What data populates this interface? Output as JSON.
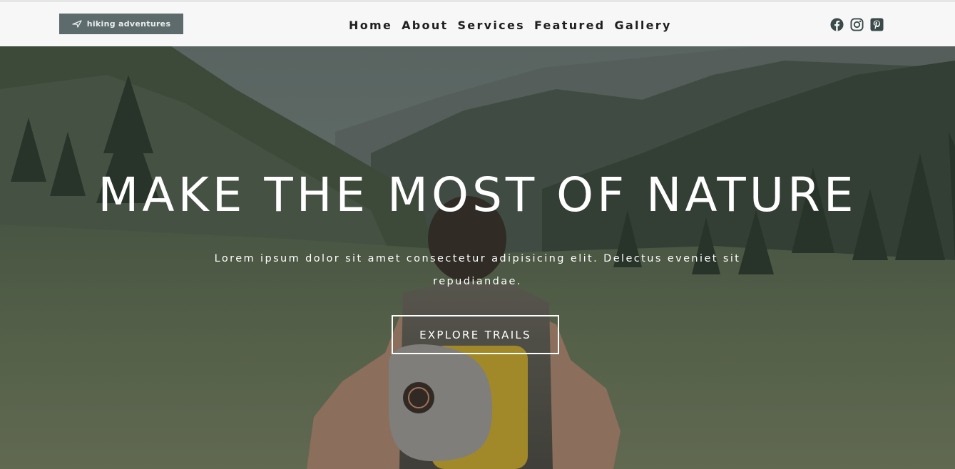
{
  "brand": {
    "label": "hiking adventures",
    "icon": "paper-plane-icon",
    "bg_color": "#5e6b6c"
  },
  "nav": {
    "items": [
      {
        "label": "Home"
      },
      {
        "label": "About"
      },
      {
        "label": "Services"
      },
      {
        "label": "Featured"
      },
      {
        "label": "Gallery"
      }
    ]
  },
  "socials": [
    {
      "icon": "facebook-icon"
    },
    {
      "icon": "instagram-icon"
    },
    {
      "icon": "pinterest-icon"
    }
  ],
  "hero": {
    "title": "MAKE THE MOST OF NATURE",
    "subtitle": "Lorem ipsum dolor sit amet consectetur adipisicing elit. Delectus eveniet sit repudiandae.",
    "cta_label": "EXPLORE TRAILS",
    "background": "mountain-valley-hiker-photo"
  }
}
